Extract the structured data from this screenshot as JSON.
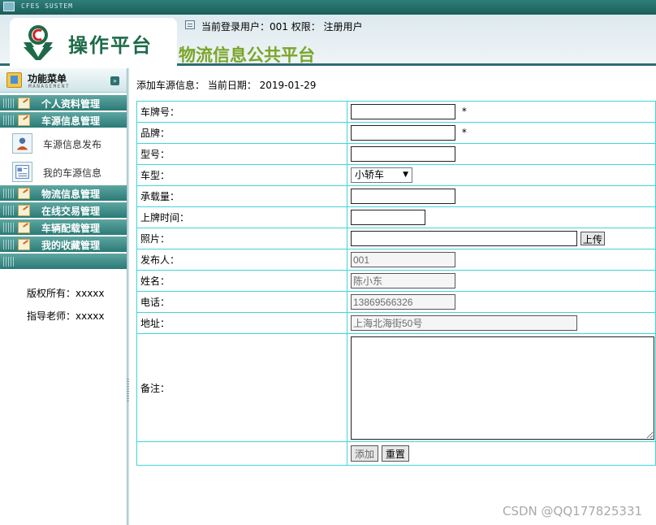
{
  "window": {
    "system_title": "CFES SUSTEM"
  },
  "header": {
    "logo_text": "操作平台",
    "user_status": "当前登录用户：001 权限： 注册用户",
    "platform_title": "物流信息公共平台"
  },
  "sidebar": {
    "menu_title": "功能菜单",
    "menu_subtitle": "MANAGEMENT",
    "collapse_glyph": "»",
    "sections": [
      {
        "label": "个人资料管理"
      },
      {
        "label": "车源信息管理"
      },
      {
        "label": "物流信息管理"
      },
      {
        "label": "在线交易管理"
      },
      {
        "label": "车辆配载管理"
      },
      {
        "label": "我的收藏管理"
      }
    ],
    "sub_items": [
      {
        "label": "车源信息发布",
        "icon": "user-card-icon"
      },
      {
        "label": "我的车源信息",
        "icon": "document-list-icon"
      }
    ],
    "copyright": "版权所有：xxxxx",
    "teacher": "指导老师：xxxxx"
  },
  "main": {
    "title": "添加车源信息： 当前日期： 2019-01-29",
    "required_mark": "*",
    "fields": {
      "plate": {
        "label": "车牌号：",
        "value": ""
      },
      "brand": {
        "label": "品牌：",
        "value": ""
      },
      "model": {
        "label": "型号：",
        "value": ""
      },
      "type": {
        "label": "车型：",
        "value": "小轿车"
      },
      "capacity": {
        "label": "承载量：",
        "value": ""
      },
      "plate_date": {
        "label": "上牌时间：",
        "value": ""
      },
      "photo": {
        "label": "照片：",
        "value": "",
        "upload_label": "上传"
      },
      "publisher": {
        "label": "发布人：",
        "value": "001"
      },
      "name": {
        "label": "姓名：",
        "value": "陈小东"
      },
      "phone": {
        "label": "电话：",
        "value": "13869566326"
      },
      "address": {
        "label": "地址：",
        "value": "上海北海街50号"
      },
      "notes": {
        "label": "备注：",
        "value": ""
      }
    },
    "add_button": "添加",
    "reset_button": "重置"
  },
  "watermark": "CSDN @QQ177825331",
  "colors": {
    "teal": "#2b7a76",
    "table_border": "#40d6d6",
    "title_green": "#7aa52a"
  }
}
